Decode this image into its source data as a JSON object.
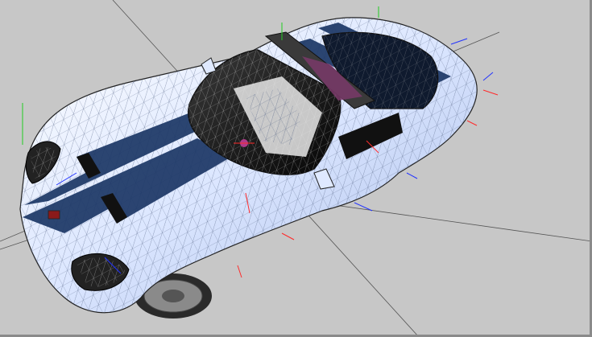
{
  "viewport": {
    "name": "3d-model-viewport",
    "background_color": "#c7c7c7",
    "wireframe_color": "#1a1a1a",
    "body_color": "#dfe9ff",
    "stripe_color": "#1c3766",
    "glass_color": "#0d0d0d",
    "axis_colors": {
      "x": "#ff2a2a",
      "y": "#22cc22",
      "z": "#2233ff"
    }
  },
  "scene": {
    "object": "sports-car-mesh",
    "render_mode": "shaded-wireframe",
    "gizmos": "bone-axis-markers"
  }
}
